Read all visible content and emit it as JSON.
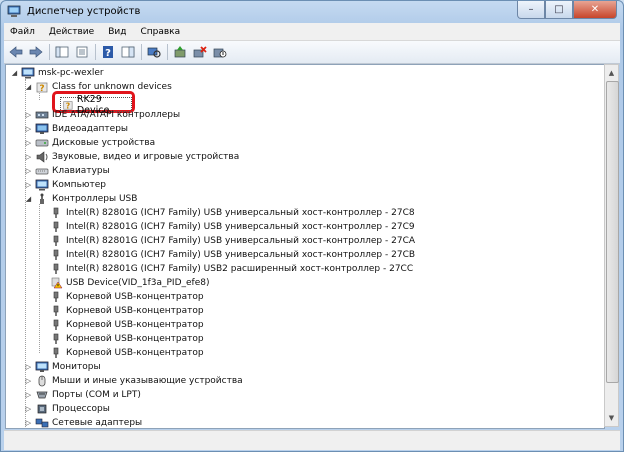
{
  "window": {
    "title": "Диспетчер устройств",
    "controls": {
      "minimize": "–",
      "maximize": "□",
      "close": "✕"
    }
  },
  "menu": [
    "Файл",
    "Действие",
    "Вид",
    "Справка"
  ],
  "toolbar": [
    "back-icon",
    "forward-icon",
    "separator",
    "show-hide-tree-icon",
    "properties-icon",
    "separator",
    "help-icon",
    "action-pane-icon",
    "separator",
    "scan-hardware-icon",
    "separator",
    "update-driver-icon",
    "uninstall-icon",
    "disable-icon"
  ],
  "tree": {
    "root": "msk-pc-wexler",
    "nodes": [
      {
        "label": "Class for unknown devices",
        "expanded": true,
        "depth": 1,
        "icon": "unknown-device-icon"
      },
      {
        "label": "RK29 Device",
        "depth": 2,
        "icon": "unknown-device-icon",
        "highlighted": true
      },
      {
        "label": "IDE ATA/ATAPI контроллеры",
        "depth": 1,
        "icon": "ide-controller-icon"
      },
      {
        "label": "Видеоадаптеры",
        "depth": 1,
        "icon": "display-adapter-icon"
      },
      {
        "label": "Дисковые устройства",
        "depth": 1,
        "icon": "disk-drive-icon"
      },
      {
        "label": "Звуковые, видео и игровые устройства",
        "depth": 1,
        "icon": "sound-icon"
      },
      {
        "label": "Клавиатуры",
        "depth": 1,
        "icon": "keyboard-icon"
      },
      {
        "label": "Компьютер",
        "depth": 1,
        "icon": "computer-icon"
      },
      {
        "label": "Контроллеры USB",
        "expanded": true,
        "depth": 1,
        "icon": "usb-controller-icon"
      },
      {
        "label": "Intel(R) 82801G (ICH7 Family) USB универсальный хост-контроллер  - 27C8",
        "depth": 2,
        "icon": "usb-plug-icon"
      },
      {
        "label": "Intel(R) 82801G (ICH7 Family) USB универсальный хост-контроллер  - 27C9",
        "depth": 2,
        "icon": "usb-plug-icon"
      },
      {
        "label": "Intel(R) 82801G (ICH7 Family) USB универсальный хост-контроллер  - 27CA",
        "depth": 2,
        "icon": "usb-plug-icon"
      },
      {
        "label": "Intel(R) 82801G (ICH7 Family) USB универсальный хост-контроллер  - 27CB",
        "depth": 2,
        "icon": "usb-plug-icon"
      },
      {
        "label": "Intel(R) 82801G (ICH7 Family) USB2 расширенный хост-контроллер - 27CC",
        "depth": 2,
        "icon": "usb-plug-icon"
      },
      {
        "label": "USB Device(VID_1f3a_PID_efe8)",
        "depth": 2,
        "icon": "warning-icon"
      },
      {
        "label": "Корневой USB-концентратор",
        "depth": 2,
        "icon": "usb-plug-icon"
      },
      {
        "label": "Корневой USB-концентратор",
        "depth": 2,
        "icon": "usb-plug-icon"
      },
      {
        "label": "Корневой USB-концентратор",
        "depth": 2,
        "icon": "usb-plug-icon"
      },
      {
        "label": "Корневой USB-концентратор",
        "depth": 2,
        "icon": "usb-plug-icon"
      },
      {
        "label": "Корневой USB-концентратор",
        "depth": 2,
        "icon": "usb-plug-icon"
      },
      {
        "label": "Мониторы",
        "depth": 1,
        "icon": "monitor-icon"
      },
      {
        "label": "Мыши и иные указывающие устройства",
        "depth": 1,
        "icon": "mouse-icon"
      },
      {
        "label": "Порты (COM и LPT)",
        "depth": 1,
        "icon": "port-icon"
      },
      {
        "label": "Процессоры",
        "depth": 1,
        "icon": "processor-icon"
      },
      {
        "label": "Сетевые адаптеры",
        "depth": 1,
        "icon": "network-adapter-icon"
      }
    ]
  },
  "colors": {
    "highlight": "#e0141b",
    "window_frame": "#aec9e8"
  }
}
